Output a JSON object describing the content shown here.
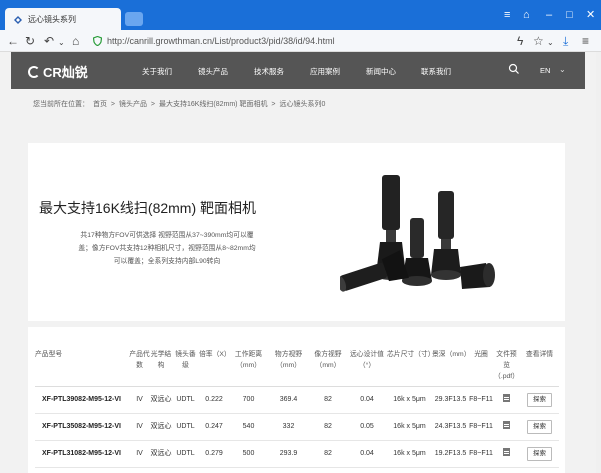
{
  "browser": {
    "tab_title": "远心镜头系列",
    "url": "http://canrill.growthman.cn/List/product3/pid/38/id/94.html"
  },
  "site": {
    "logo_text": "CR灿锐",
    "menu": [
      "关于我们",
      "镜头产品",
      "技术服务",
      "应用案例",
      "新闻中心",
      "联系我们"
    ],
    "lang": "EN"
  },
  "breadcrumb": [
    "您当前所在位置：",
    "首页",
    ">",
    "镜头产品",
    ">",
    "最大支持16K线扫(82mm) 靶面相机",
    ">",
    "远心镜头系列0"
  ],
  "product": {
    "title": "最大支持16K线扫(82mm) 靶面相机",
    "desc_lines": [
      "共17种物方FOV可供选择  视野范围从37~390mm均可以覆",
      "盖；像方FOV共支持12种相机尺寸，视野范围从8~82mm均",
      "可以覆盖；全系列支持内部L90转向"
    ]
  },
  "table": {
    "headers": [
      "产品型号",
      "产品代数",
      "光学结构",
      "镜头番级",
      "倍率（X）",
      "工作距离（mm）",
      "物方视野（mm）",
      "像方视野（mm）",
      "远心设计值（°）",
      "芯片尺寸（寸）",
      "景深（mm）",
      "光圈",
      "文件预览（.pdf）",
      "查看详情"
    ],
    "rows": [
      [
        "XF-PTL39082-M95-12-VI",
        "IV",
        "双远心",
        "UDTL",
        "0.222",
        "700",
        "369.4",
        "82",
        "0.04",
        "16k x 5μm",
        "29.3",
        "F8~F11",
        "",
        "探索"
      ],
      [
        "XF-PTL35082-M95-12-VI",
        "IV",
        "双远心",
        "UDTL",
        "0.247",
        "540",
        "332",
        "82",
        "0.05",
        "16k x 5μm",
        "24.3",
        "F8~F11",
        "",
        "探索"
      ],
      [
        "XF-PTL31082-M95-12-VI",
        "IV",
        "双远心",
        "UDTL",
        "0.279",
        "500",
        "293.9",
        "82",
        "0.04",
        "16k x 5μm",
        "19.2",
        "F8~F11",
        "",
        "探索"
      ]
    ],
    "lens_icon": "F13.5"
  },
  "icons": {
    "back": "back-arrow-icon",
    "forward": "forward-arrow-icon",
    "refresh": "refresh-icon",
    "home": "home-icon",
    "search": "search-icon"
  },
  "colors": {
    "titlebar": "#1a6fd8",
    "site_nav": "#555555",
    "page_bg": "#f2f2f2"
  }
}
